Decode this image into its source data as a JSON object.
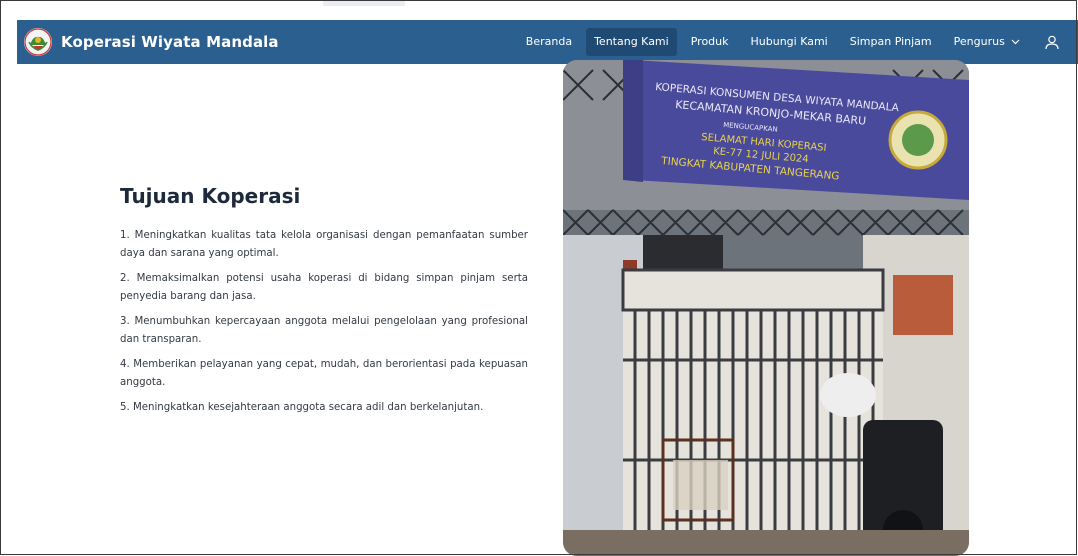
{
  "brand": {
    "title": "Koperasi Wiyata Mandala",
    "logo_icon": "cooperative-logo-icon"
  },
  "nav": {
    "items": [
      {
        "label": "Beranda",
        "active": false
      },
      {
        "label": "Tentang Kami",
        "active": true
      },
      {
        "label": "Produk",
        "active": false
      },
      {
        "label": "Hubungi Kami",
        "active": false
      },
      {
        "label": "Simpan Pinjam",
        "active": false
      },
      {
        "label": "Pengurus",
        "active": false,
        "dropdown": true
      }
    ],
    "user_icon": "user-icon"
  },
  "section": {
    "title": "Tujuan Koperasi",
    "goals": [
      "1. Meningkatkan kualitas tata kelola organisasi dengan pemanfaatan sumber daya dan sarana yang optimal.",
      "2. Memaksimalkan potensi usaha koperasi di bidang simpan pinjam serta penyedia barang dan jasa.",
      "3. Menumbuhkan kepercayaan anggota melalui pengelolaan yang profesional dan transparan.",
      "4. Memberikan pelayanan yang cepat, mudah, dan berorientasi pada kepuasan anggota.",
      "5. Meningkatkan kesejahteraan anggota secara adil dan berkelanjutan."
    ]
  },
  "photo": {
    "banner_lines": [
      "KOPERASI KONSUMEN DESA WIYATA MANDALA",
      "KECAMATAN KRONJO-MEKAR BARU",
      "MENGUCAPKAN",
      "SELAMAT HARI KOPERASI",
      "KE-77  12 JULI 2024",
      "TINGKAT KABUPATEN TANGERANG"
    ]
  },
  "colors": {
    "navbar": "#2b5f8f",
    "nav_active": "#1f4a73",
    "title": "#1e2a3b",
    "body_text": "#333a44"
  }
}
